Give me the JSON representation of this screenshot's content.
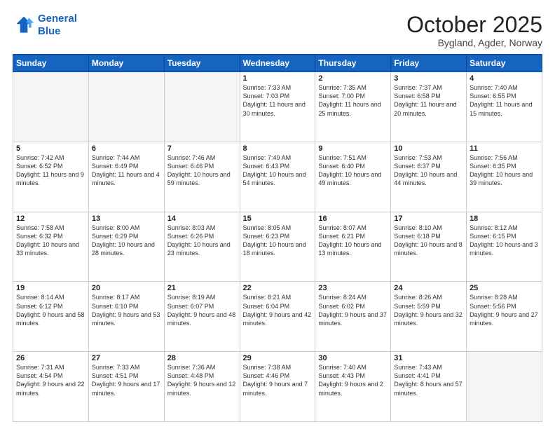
{
  "header": {
    "logo_line1": "General",
    "logo_line2": "Blue",
    "month": "October 2025",
    "location": "Bygland, Agder, Norway"
  },
  "weekdays": [
    "Sunday",
    "Monday",
    "Tuesday",
    "Wednesday",
    "Thursday",
    "Friday",
    "Saturday"
  ],
  "weeks": [
    [
      {
        "day": "",
        "text": ""
      },
      {
        "day": "",
        "text": ""
      },
      {
        "day": "",
        "text": ""
      },
      {
        "day": "1",
        "text": "Sunrise: 7:33 AM\nSunset: 7:03 PM\nDaylight: 11 hours\nand 30 minutes."
      },
      {
        "day": "2",
        "text": "Sunrise: 7:35 AM\nSunset: 7:00 PM\nDaylight: 11 hours\nand 25 minutes."
      },
      {
        "day": "3",
        "text": "Sunrise: 7:37 AM\nSunset: 6:58 PM\nDaylight: 11 hours\nand 20 minutes."
      },
      {
        "day": "4",
        "text": "Sunrise: 7:40 AM\nSunset: 6:55 PM\nDaylight: 11 hours\nand 15 minutes."
      }
    ],
    [
      {
        "day": "5",
        "text": "Sunrise: 7:42 AM\nSunset: 6:52 PM\nDaylight: 11 hours\nand 9 minutes."
      },
      {
        "day": "6",
        "text": "Sunrise: 7:44 AM\nSunset: 6:49 PM\nDaylight: 11 hours\nand 4 minutes."
      },
      {
        "day": "7",
        "text": "Sunrise: 7:46 AM\nSunset: 6:46 PM\nDaylight: 10 hours\nand 59 minutes."
      },
      {
        "day": "8",
        "text": "Sunrise: 7:49 AM\nSunset: 6:43 PM\nDaylight: 10 hours\nand 54 minutes."
      },
      {
        "day": "9",
        "text": "Sunrise: 7:51 AM\nSunset: 6:40 PM\nDaylight: 10 hours\nand 49 minutes."
      },
      {
        "day": "10",
        "text": "Sunrise: 7:53 AM\nSunset: 6:37 PM\nDaylight: 10 hours\nand 44 minutes."
      },
      {
        "day": "11",
        "text": "Sunrise: 7:56 AM\nSunset: 6:35 PM\nDaylight: 10 hours\nand 39 minutes."
      }
    ],
    [
      {
        "day": "12",
        "text": "Sunrise: 7:58 AM\nSunset: 6:32 PM\nDaylight: 10 hours\nand 33 minutes."
      },
      {
        "day": "13",
        "text": "Sunrise: 8:00 AM\nSunset: 6:29 PM\nDaylight: 10 hours\nand 28 minutes."
      },
      {
        "day": "14",
        "text": "Sunrise: 8:03 AM\nSunset: 6:26 PM\nDaylight: 10 hours\nand 23 minutes."
      },
      {
        "day": "15",
        "text": "Sunrise: 8:05 AM\nSunset: 6:23 PM\nDaylight: 10 hours\nand 18 minutes."
      },
      {
        "day": "16",
        "text": "Sunrise: 8:07 AM\nSunset: 6:21 PM\nDaylight: 10 hours\nand 13 minutes."
      },
      {
        "day": "17",
        "text": "Sunrise: 8:10 AM\nSunset: 6:18 PM\nDaylight: 10 hours\nand 8 minutes."
      },
      {
        "day": "18",
        "text": "Sunrise: 8:12 AM\nSunset: 6:15 PM\nDaylight: 10 hours\nand 3 minutes."
      }
    ],
    [
      {
        "day": "19",
        "text": "Sunrise: 8:14 AM\nSunset: 6:12 PM\nDaylight: 9 hours\nand 58 minutes."
      },
      {
        "day": "20",
        "text": "Sunrise: 8:17 AM\nSunset: 6:10 PM\nDaylight: 9 hours\nand 53 minutes."
      },
      {
        "day": "21",
        "text": "Sunrise: 8:19 AM\nSunset: 6:07 PM\nDaylight: 9 hours\nand 48 minutes."
      },
      {
        "day": "22",
        "text": "Sunrise: 8:21 AM\nSunset: 6:04 PM\nDaylight: 9 hours\nand 42 minutes."
      },
      {
        "day": "23",
        "text": "Sunrise: 8:24 AM\nSunset: 6:02 PM\nDaylight: 9 hours\nand 37 minutes."
      },
      {
        "day": "24",
        "text": "Sunrise: 8:26 AM\nSunset: 5:59 PM\nDaylight: 9 hours\nand 32 minutes."
      },
      {
        "day": "25",
        "text": "Sunrise: 8:28 AM\nSunset: 5:56 PM\nDaylight: 9 hours\nand 27 minutes."
      }
    ],
    [
      {
        "day": "26",
        "text": "Sunrise: 7:31 AM\nSunset: 4:54 PM\nDaylight: 9 hours\nand 22 minutes."
      },
      {
        "day": "27",
        "text": "Sunrise: 7:33 AM\nSunset: 4:51 PM\nDaylight: 9 hours\nand 17 minutes."
      },
      {
        "day": "28",
        "text": "Sunrise: 7:36 AM\nSunset: 4:48 PM\nDaylight: 9 hours\nand 12 minutes."
      },
      {
        "day": "29",
        "text": "Sunrise: 7:38 AM\nSunset: 4:46 PM\nDaylight: 9 hours\nand 7 minutes."
      },
      {
        "day": "30",
        "text": "Sunrise: 7:40 AM\nSunset: 4:43 PM\nDaylight: 9 hours\nand 2 minutes."
      },
      {
        "day": "31",
        "text": "Sunrise: 7:43 AM\nSunset: 4:41 PM\nDaylight: 8 hours\nand 57 minutes."
      },
      {
        "day": "",
        "text": ""
      }
    ]
  ]
}
